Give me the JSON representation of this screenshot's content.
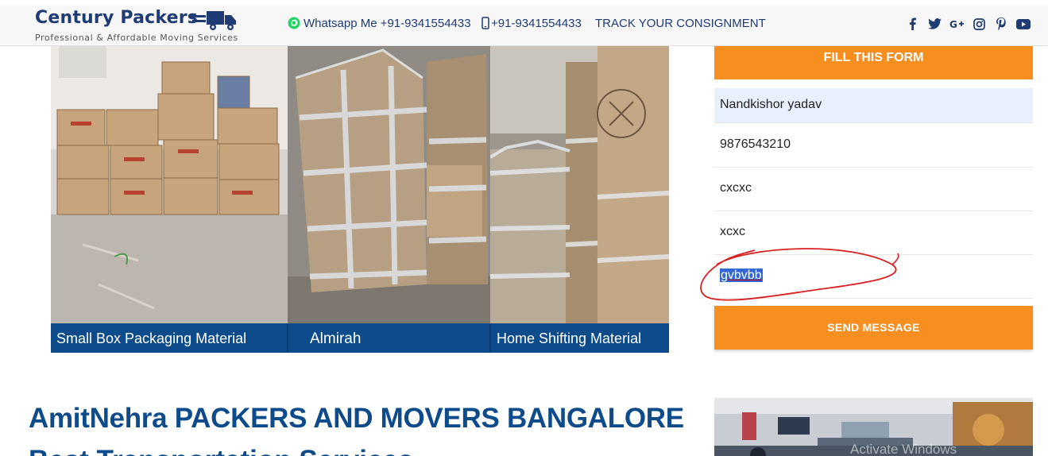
{
  "header": {
    "brand": "Century Packers",
    "tagline": "Professional & Affordable Moving Services",
    "whatsapp": "Whatsapp Me +91-9341554433",
    "phone": "+91-9341554433",
    "track": "TRACK YOUR CONSIGNMENT",
    "social_icons": [
      "facebook-icon",
      "twitter-icon",
      "google-plus-icon",
      "instagram-icon",
      "pinterest-icon",
      "youtube-icon"
    ]
  },
  "banner": {
    "captions": [
      "Small Box Packaging Material",
      "Almirah",
      "Home Shifting Material"
    ]
  },
  "form": {
    "title": "FILL THIS FORM",
    "fields": [
      "Nandkishor yadav",
      "9876543210",
      "cxcxc",
      "xcxc",
      "gvbvbb"
    ],
    "submit_label": "SEND MESSAGE"
  },
  "main": {
    "heading": "AmitNehra PACKERS AND MOVERS BANGALORE",
    "heading_2": "Best Transportation Services"
  },
  "overlay": {
    "watermark": "Activate Windows"
  },
  "colors": {
    "brand_blue": "#1f3b73",
    "heading_blue": "#0d4b8a",
    "accent_orange": "#f78f20"
  }
}
